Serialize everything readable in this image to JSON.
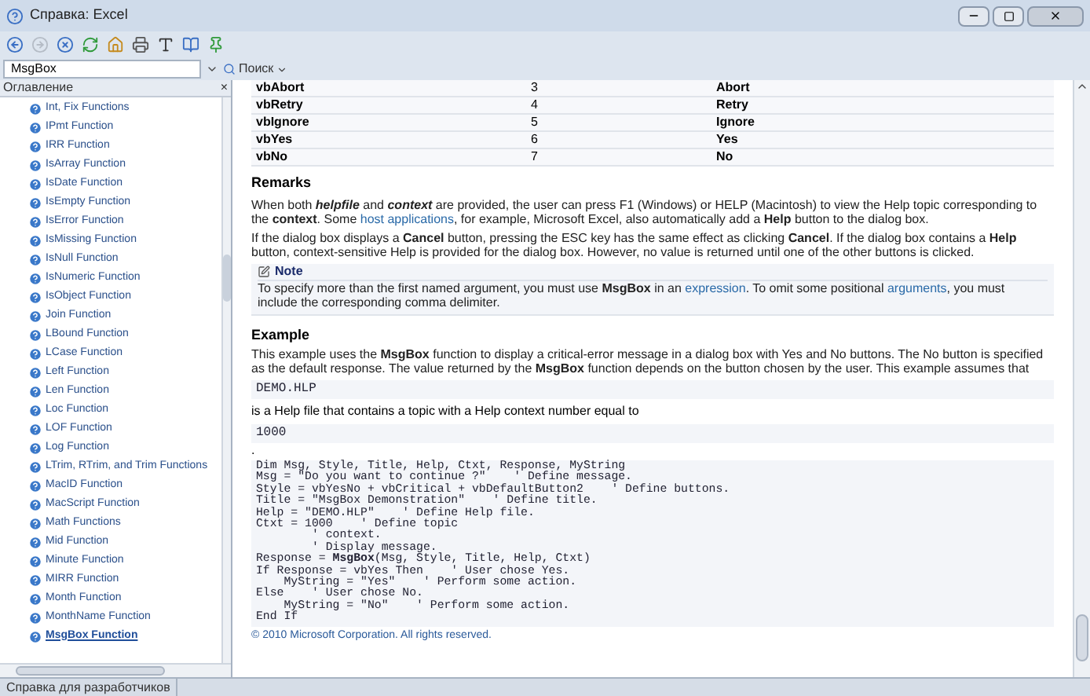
{
  "window": {
    "title": "Справка: Excel"
  },
  "toolbar": [
    {
      "kind": "back",
      "disabled": false
    },
    {
      "kind": "forward",
      "disabled": true
    },
    {
      "kind": "stop",
      "disabled": false
    },
    {
      "kind": "refresh",
      "disabled": false
    },
    {
      "kind": "home",
      "disabled": false
    },
    {
      "kind": "print",
      "disabled": false
    },
    {
      "kind": "font",
      "disabled": false
    },
    {
      "kind": "book",
      "disabled": false
    },
    {
      "kind": "pin",
      "disabled": false
    }
  ],
  "search": {
    "value": "MsgBox",
    "button": "Поиск"
  },
  "sidebar": {
    "title": "Оглавление",
    "close": "×",
    "items": [
      {
        "label": "Int, Fix Functions",
        "selected": false
      },
      {
        "label": "IPmt Function",
        "selected": false
      },
      {
        "label": "IRR Function",
        "selected": false
      },
      {
        "label": "IsArray Function",
        "selected": false
      },
      {
        "label": "IsDate Function",
        "selected": false
      },
      {
        "label": "IsEmpty Function",
        "selected": false
      },
      {
        "label": "IsError Function",
        "selected": false
      },
      {
        "label": "IsMissing Function",
        "selected": false
      },
      {
        "label": "IsNull Function",
        "selected": false
      },
      {
        "label": "IsNumeric Function",
        "selected": false
      },
      {
        "label": "IsObject Function",
        "selected": false
      },
      {
        "label": "Join Function",
        "selected": false
      },
      {
        "label": "LBound Function",
        "selected": false
      },
      {
        "label": "LCase Function",
        "selected": false
      },
      {
        "label": "Left Function",
        "selected": false
      },
      {
        "label": "Len Function",
        "selected": false
      },
      {
        "label": "Loc Function",
        "selected": false
      },
      {
        "label": "LOF Function",
        "selected": false
      },
      {
        "label": "Log Function",
        "selected": false
      },
      {
        "label": "LTrim, RTrim, and Trim Functions",
        "selected": false
      },
      {
        "label": "MacID Function",
        "selected": false
      },
      {
        "label": "MacScript Function",
        "selected": false
      },
      {
        "label": "Math Functions",
        "selected": false
      },
      {
        "label": "Mid Function",
        "selected": false
      },
      {
        "label": "Minute Function",
        "selected": false
      },
      {
        "label": "MIRR Function",
        "selected": false
      },
      {
        "label": "Month Function",
        "selected": false
      },
      {
        "label": "MonthName Function",
        "selected": false
      },
      {
        "label": "MsgBox Function",
        "selected": true
      }
    ]
  },
  "table": {
    "rows": [
      {
        "constant": "vbAbort",
        "value": "3",
        "description": "Abort"
      },
      {
        "constant": "vbRetry",
        "value": "4",
        "description": "Retry"
      },
      {
        "constant": "vbIgnore",
        "value": "5",
        "description": "Ignore"
      },
      {
        "constant": "vbYes",
        "value": "6",
        "description": "Yes"
      },
      {
        "constant": "vbNo",
        "value": "7",
        "description": "No"
      }
    ]
  },
  "remarks": {
    "heading": "Remarks",
    "paragraphs": [
      [
        {
          "kind": "text",
          "text": "When both "
        },
        {
          "kind": "bold_italic",
          "text": "helpfile"
        },
        {
          "kind": "text",
          "text": " and "
        },
        {
          "kind": "bold_italic",
          "text": "context"
        },
        {
          "kind": "text",
          "text": " are provided, the user can press F1 (Windows) or HELP (Macintosh) to view the Help topic corresponding to the **context**. Some "
        },
        {
          "kind": "link",
          "text": "host applications"
        },
        {
          "kind": "text",
          "text": ", for example, Microsoft Excel, also automatically add a **Help** button to the dialog box."
        }
      ],
      [
        {
          "kind": "text",
          "text": "If the dialog box displays a **Cancel** button, pressing the ESC key has the same effect as clicking **Cancel**. If the dialog box contains a **Help** button, context-sensitive Help is provided for the dialog box. However, no value is returned until one of the other buttons is clicked."
        }
      ]
    ],
    "note": {
      "title": "Note",
      "body": [
        {
          "kind": "text",
          "text": "To specify more than the first named argument, you must use **MsgBox** in an "
        },
        {
          "kind": "link",
          "text": "expression"
        },
        {
          "kind": "text",
          "text": ". To omit some positional "
        },
        {
          "kind": "link",
          "text": "arguments"
        },
        {
          "kind": "text",
          "text": ", you must include the corresponding comma delimiter."
        }
      ]
    }
  },
  "example": {
    "heading": "Example",
    "intro": "This example uses the **MsgBox** function to display a critical-error message in a dialog box with Yes and No buttons. The No button is specified as the default response. The value returned by the **MsgBox** function depends on the button chosen by the user. This example assumes that",
    "file": "DEMO.HLP",
    "between": "is a Help file that contains a topic with a Help context number equal to",
    "number": "1000",
    "dot": ".",
    "code": [
      "Dim Msg, Style, Title, Help, Ctxt, Response, MyString",
      "Msg = \"Do you want to continue ?\"    ' Define message.",
      "Style = vbYesNo + vbCritical + vbDefaultButton2    ' Define buttons.",
      "Title = \"MsgBox Demonstration\"    ' Define title.",
      "Help = \"DEMO.HLP\"    ' Define Help file.",
      "Ctxt = 1000    ' Define topic",
      "        ' context.",
      "        ' Display message.",
      "Response = **MsgBox**(Msg, Style, Title, Help, Ctxt)",
      "If Response = vbYes Then    ' User chose Yes.",
      "    MyString = \"Yes\"    ' Perform some action.",
      "Else    ' User chose No.",
      "    MyString = \"No\"    ' Perform some action.",
      "End If"
    ]
  },
  "copyright": "© 2010 Microsoft Corporation. All rights reserved.",
  "status_bar": {
    "tab": "Справка для разработчиков"
  }
}
